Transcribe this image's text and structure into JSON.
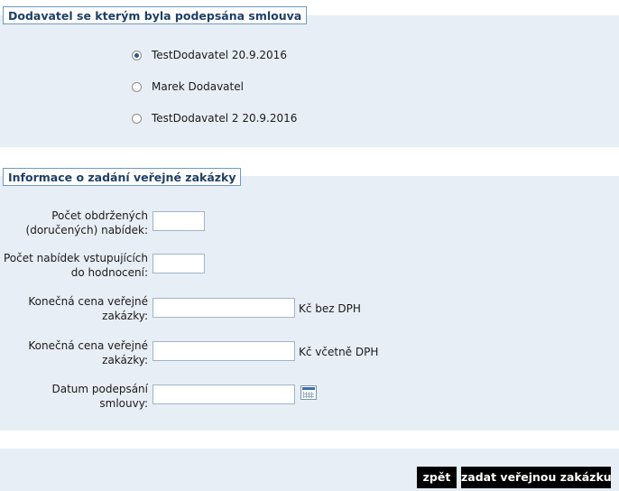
{
  "supplier_section": {
    "legend": "Dodavatel se kterým byla podepsána smlouva",
    "options": [
      {
        "label": "TestDodavatel 20.9.2016",
        "selected": true
      },
      {
        "label": "Marek Dodavatel",
        "selected": false
      },
      {
        "label": "TestDodavatel 2 20.9.2016",
        "selected": false
      }
    ]
  },
  "info_section": {
    "legend": "Informace o zadání veřejné zakázky",
    "fields": {
      "offers_received": {
        "label_line1": "Počet obdržených",
        "label_line2": "(doručených) nabídek:",
        "value": ""
      },
      "offers_evaluated": {
        "label_line1": "Počet nabídek vstupujících",
        "label_line2": "do hodnocení:",
        "value": ""
      },
      "price_without_vat": {
        "label_line1": "Konečná cena veřejné",
        "label_line2": "zakázky:",
        "value": "",
        "unit": "Kč bez DPH"
      },
      "price_with_vat": {
        "label_line1": "Konečná cena veřejné",
        "label_line2": "zakázky:",
        "value": "",
        "unit": "Kč včetně DPH"
      },
      "signing_date": {
        "label_line1": "Datum podepsání",
        "label_line2": "smlouvy:",
        "value": ""
      }
    }
  },
  "icons": {
    "calendar": "calendar-icon"
  },
  "actions": {
    "back_label": "zpět",
    "submit_label": "zadat veřejnou zakázku"
  },
  "colors": {
    "panel": "#e8eef5",
    "legend_border": "#6d9bc0",
    "legend_text": "#1f3f66",
    "button": "#000000"
  }
}
